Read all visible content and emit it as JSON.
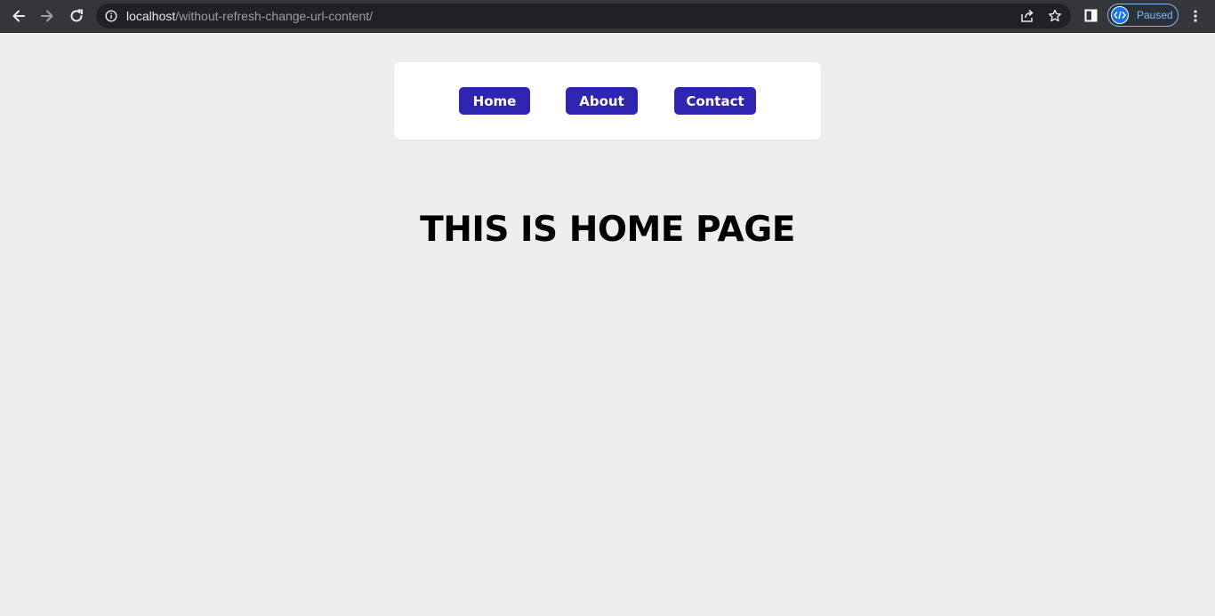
{
  "browser": {
    "url_host": "localhost",
    "url_path": "/without-refresh-change-url-content/",
    "profile_label": "Paused",
    "icons": {
      "back": "arrow-left-icon",
      "forward": "arrow-right-icon",
      "reload": "reload-icon",
      "site_info": "info-icon",
      "share": "share-icon",
      "bookmark": "star-icon",
      "side_panel": "side-panel-icon",
      "profile": "code-avatar-icon",
      "menu": "kebab-menu-icon"
    }
  },
  "nav": {
    "links": [
      {
        "label": "Home"
      },
      {
        "label": "About"
      },
      {
        "label": "Contact"
      }
    ]
  },
  "main": {
    "heading": "THIS IS HOME PAGE"
  },
  "colors": {
    "page_background": "#eeeeee",
    "button": "#3025b0",
    "button_text": "#ffffff",
    "card": "#ffffff",
    "chrome_toolbar": "#35363a",
    "omnibox": "#202124",
    "profile_accent": "#8ab4f8"
  }
}
